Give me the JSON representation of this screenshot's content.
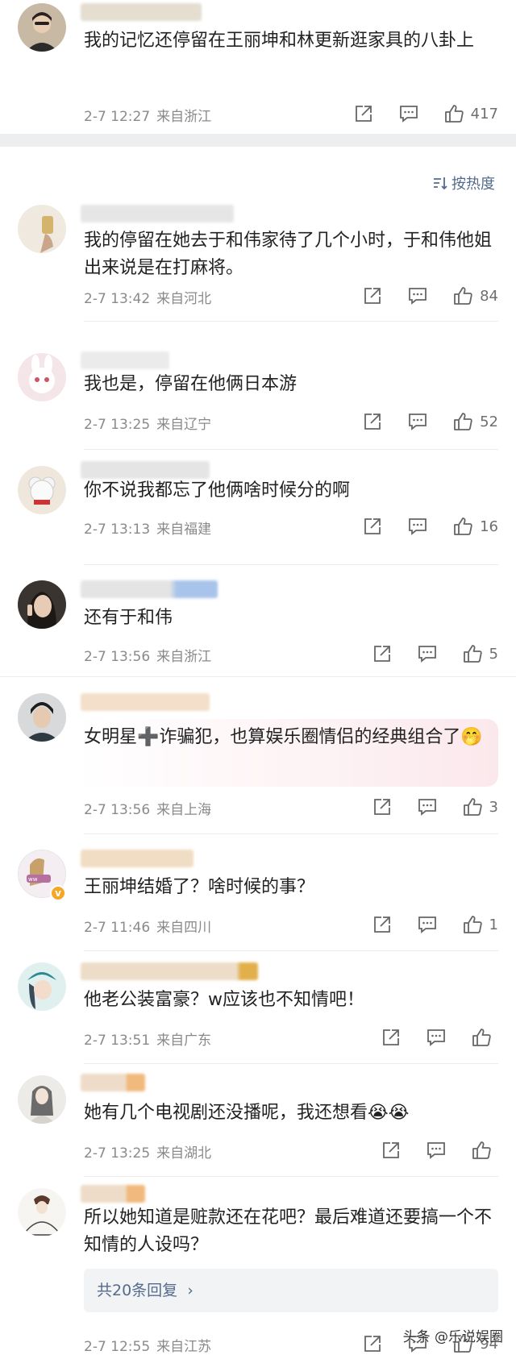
{
  "sort": {
    "label": "按热度",
    "icon": "sort-icon"
  },
  "comments": [
    {
      "text": "我的记忆还停留在王丽坤和林更新逛家具的八卦上",
      "time": "2-7 12:27",
      "location": "来自浙江",
      "likes": "417",
      "avatar_color": "#b9a58e",
      "name_color": "#d8d8d8"
    },
    {
      "text": "我的停留在她去于和伟家待了几个小时，于和伟他姐出来说是在打麻将。",
      "time": "2-7 13:42",
      "location": "来自河北",
      "likes": "84",
      "avatar_color": "#d9cbb5",
      "name_color": "#dcdcdc"
    },
    {
      "text": "我也是，停留在他俩日本游",
      "time": "2-7 13:25",
      "location": "来自辽宁",
      "likes": "52",
      "avatar_color": "#f0c9cf",
      "name_color": "#e2e2e2"
    },
    {
      "text": "你不说我都忘了他俩啥时候分的啊",
      "time": "2-7 13:13",
      "location": "来自福建",
      "likes": "16",
      "avatar_color": "#c9b79b",
      "name_color": "#dedede"
    },
    {
      "text": "还有于和伟",
      "time": "2-7 13:56",
      "location": "来自浙江",
      "likes": "5",
      "avatar_color": "#7c6a5c",
      "name_color": "#cfdcec"
    },
    {
      "text": "女明星➕诈骗犯，也算娱乐圈情侣的经典组合了🤭",
      "time": "2-7 13:56",
      "location": "来自上海",
      "likes": "3",
      "avatar_color": "#5e6b73",
      "name_color": "#f6e3cf"
    },
    {
      "text": "王丽坤结婚了？啥时候的事？",
      "time": "2-7 11:46",
      "location": "来自四川",
      "likes": "1",
      "avatar_color": "#c7a3b8",
      "name_color": "#f2dcc8"
    },
    {
      "text": "他老公装富豪？w应该也不知情吧！",
      "time": "2-7 13:51",
      "location": "来自广东",
      "likes": "",
      "avatar_color": "#9cc4c9",
      "name_color": "#f3e0c9"
    },
    {
      "text": "她有几个电视剧还没播呢，我还想看😭😭",
      "time": "2-7 13:25",
      "location": "来自湖北",
      "likes": "",
      "avatar_color": "#d8d2c8",
      "name_color": "#efd9c6"
    },
    {
      "text": "所以她知道是赃款还在花吧？最后难道还要搞一个不知情的人设吗？",
      "time": "2-7 12:55",
      "location": "来自江苏",
      "likes": "94",
      "avatar_color": "#e6e2dc",
      "name_color": "#efd7c4"
    }
  ],
  "replies_label": "共20条回复",
  "watermark": "头条 @乐说娱圈",
  "icons": {
    "share": "share-icon",
    "comment": "comment-icon",
    "like": "thumbs-up-icon"
  },
  "colors": {
    "link": "#546b8c",
    "meta": "#8a8a8a",
    "separator": "#eceef0"
  }
}
